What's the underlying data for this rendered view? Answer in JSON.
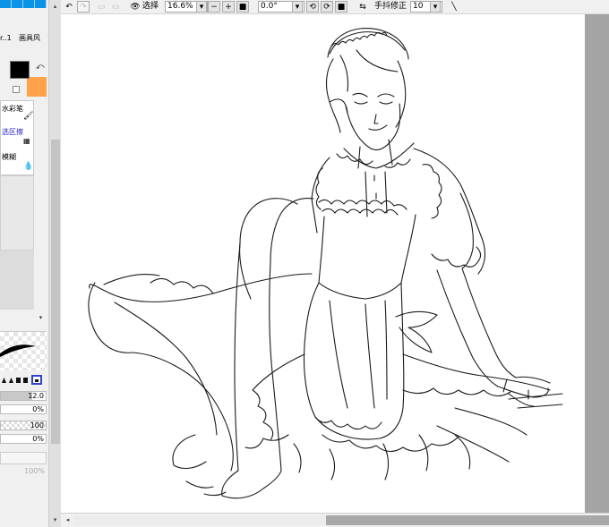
{
  "palette": {
    "primary_color": "#000000",
    "secondary_color": "#ffa24a",
    "accent": "#0a93e8"
  },
  "tool_tabs": [
    {
      "label": "r..1"
    },
    {
      "label": "画具风"
    }
  ],
  "brushes": [
    {
      "label": "水彩笔",
      "icon": "brush-icon"
    },
    {
      "label": "选区擦",
      "icon": "selection-eraser-icon"
    },
    {
      "label": "模糊",
      "icon": "droplet-icon"
    }
  ],
  "brush_settings": {
    "size_value": "12.0",
    "density_value": "0%",
    "opacity_value": "100",
    "blend_value": "0%",
    "bottom_value": "100%"
  },
  "toolbar": {
    "selection_label": "选择",
    "zoom_value": "16.6%",
    "rotation_value": "0.0°",
    "stabilizer_label": "手抖修正",
    "stabilizer_value": "10"
  }
}
